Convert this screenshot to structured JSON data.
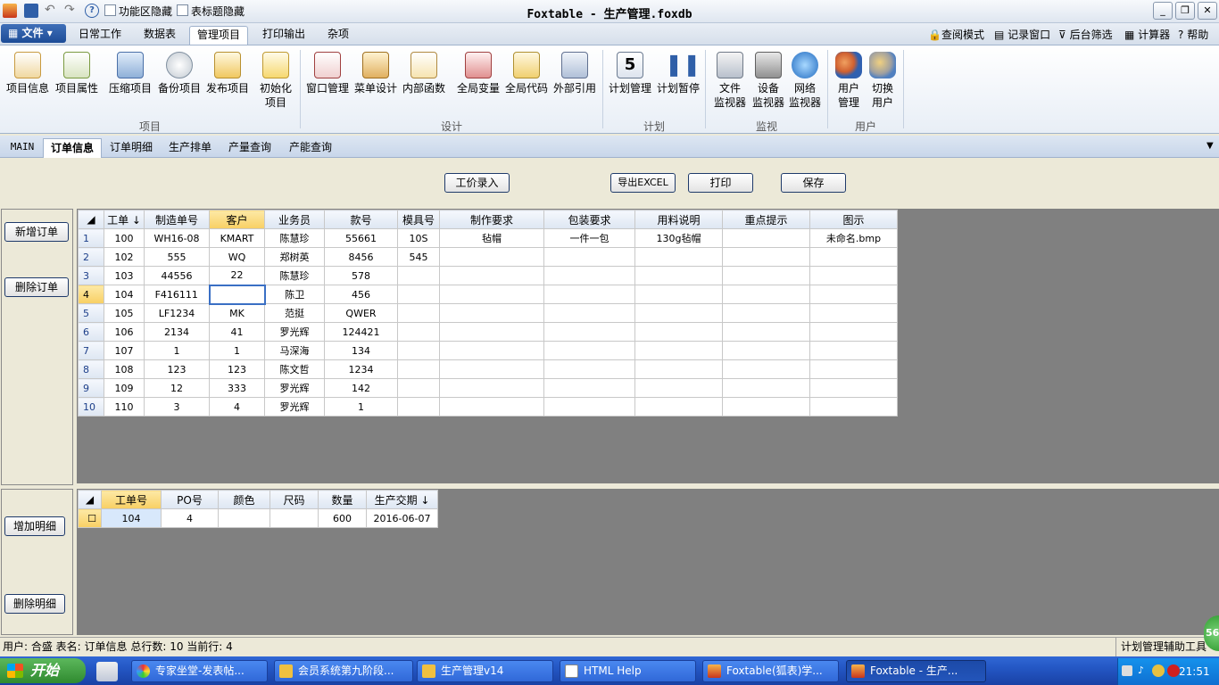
{
  "window": {
    "title": "Foxtable - 生产管理.foxdb",
    "quick_access": {
      "opt1": "功能区隐藏",
      "opt2": "表标题隐藏"
    }
  },
  "ribbon": {
    "file_label": "文件",
    "tabs": [
      "日常工作",
      "数据表",
      "管理项目",
      "打印输出",
      "杂项"
    ],
    "active_tab": "管理项目",
    "tools": [
      "查阅模式",
      "记录窗口",
      "后台筛选",
      "计算器",
      "帮助"
    ],
    "groups": {
      "project": {
        "label": "项目",
        "buttons": [
          "项目信息",
          "项目属性",
          "压缩项目",
          "备份项目",
          "发布项目",
          "初始化\n项目"
        ]
      },
      "design": {
        "label": "设计",
        "buttons": [
          "窗口管理",
          "菜单设计",
          "内部函数",
          "全局变量",
          "全局代码",
          "外部引用"
        ]
      },
      "plan": {
        "label": "计划",
        "buttons": [
          "计划管理",
          "计划暂停"
        ]
      },
      "monitor": {
        "label": "监视",
        "buttons": [
          "文件\n监视器",
          "设备\n监视器",
          "网络\n监视器"
        ]
      },
      "user": {
        "label": "用户",
        "buttons": [
          "用户\n管理",
          "切换\n用户"
        ]
      }
    }
  },
  "doc_tabs": [
    "MAIN",
    "订单信息",
    "订单明细",
    "生产排单",
    "产量查询",
    "产能查询"
  ],
  "active_doc_tab": "订单信息",
  "toolbar": {
    "btn_labor": "工价录入",
    "btn_export": "导出EXCEL",
    "btn_print": "打印",
    "btn_save": "保存"
  },
  "left_buttons": {
    "add_order": "新增订单",
    "del_order": "删除订单",
    "add_detail": "增加明细",
    "del_detail": "删除明细"
  },
  "orders": {
    "columns": [
      "工单 ↓",
      "制造单号",
      "客户",
      "业务员",
      "款号",
      "模具号",
      "制作要求",
      "包装要求",
      "用料说明",
      "重点提示",
      "图示"
    ],
    "rows": [
      [
        "1",
        "100",
        "WH16-08",
        "KMART",
        "陈慧珍",
        "55661",
        "10S",
        "毡帽",
        "一件一包",
        "130g毡帽",
        "",
        "未命名.bmp"
      ],
      [
        "2",
        "102",
        "555",
        "WQ",
        "郑树英",
        "8456",
        "545",
        "",
        "",
        "",
        "",
        ""
      ],
      [
        "3",
        "103",
        "44556",
        "22",
        "陈慧珍",
        "578",
        "",
        "",
        "",
        "",
        "",
        ""
      ],
      [
        "4",
        "104",
        "F416111",
        "",
        "陈卫",
        "456",
        "",
        "",
        "",
        "",
        "",
        ""
      ],
      [
        "5",
        "105",
        "LF1234",
        "MK",
        "范挺",
        "QWER",
        "",
        "",
        "",
        "",
        "",
        ""
      ],
      [
        "6",
        "106",
        "2134",
        "41",
        "罗光辉",
        "124421",
        "",
        "",
        "",
        "",
        "",
        ""
      ],
      [
        "7",
        "107",
        "1",
        "1",
        "马深海",
        "134",
        "",
        "",
        "",
        "",
        "",
        ""
      ],
      [
        "8",
        "108",
        "123",
        "123",
        "陈文哲",
        "1234",
        "",
        "",
        "",
        "",
        "",
        ""
      ],
      [
        "9",
        "109",
        "12",
        "333",
        "罗光辉",
        "142",
        "",
        "",
        "",
        "",
        "",
        ""
      ],
      [
        "10",
        "110",
        "3",
        "4",
        "罗光辉",
        "1",
        "",
        "",
        "",
        "",
        "",
        ""
      ]
    ]
  },
  "details": {
    "columns": [
      "工单号",
      "PO号",
      "颜色",
      "尺码",
      "数量",
      "生产交期 ↓"
    ],
    "rows": [
      [
        "104",
        "4",
        "",
        "",
        "600",
        "2016-06-07"
      ]
    ]
  },
  "status": {
    "text": "用户: 合盛 表名: 订单信息 总行数: 10 当前行: 4",
    "right": "计划管理辅助工具",
    "badge": "56"
  },
  "taskbar": {
    "start": "开始",
    "items": [
      "专家坐堂-发表帖...",
      "会员系统第九阶段...",
      "生产管理v14",
      "HTML Help",
      "Foxtable(狐表)学...",
      "Foxtable - 生产..."
    ],
    "clock": "21:51"
  },
  "colors": {
    "accent": "#3a6fc4",
    "grid_gray": "#808080",
    "header_selected": "#f8cf63"
  }
}
